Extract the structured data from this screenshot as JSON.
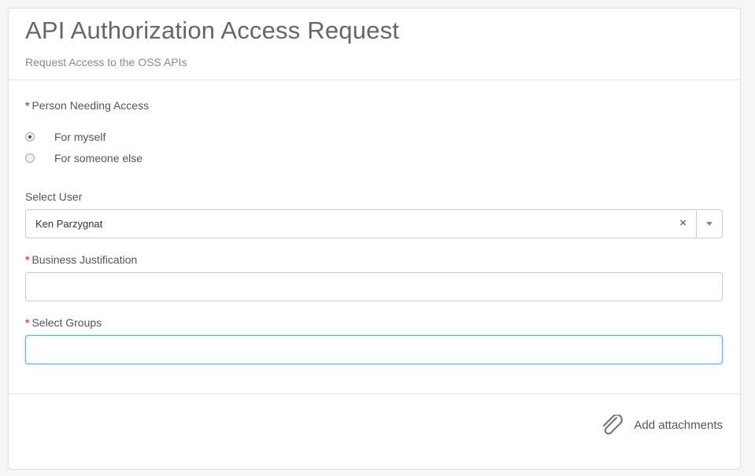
{
  "header": {
    "title": "API Authorization Access Request",
    "subtitle": "Request Access to the OSS APIs"
  },
  "form": {
    "person_field": {
      "required_mark": "*",
      "label": "Person Needing Access",
      "options": [
        {
          "label": "For myself",
          "checked": true
        },
        {
          "label": "For someone else",
          "checked": false
        }
      ]
    },
    "select_user": {
      "label": "Select User",
      "value": "Ken Parzygnat",
      "clear_symbol": "×"
    },
    "business_justification": {
      "required_mark": "*",
      "label": "Business Justification",
      "value": ""
    },
    "select_groups": {
      "required_mark": "*",
      "label": "Select Groups",
      "value": ""
    }
  },
  "footer": {
    "attach_label": "Add attachments"
  },
  "colors": {
    "required": "#d9534f",
    "focus": "#66afe9"
  }
}
